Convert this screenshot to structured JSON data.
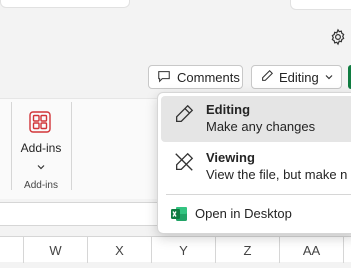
{
  "toolbar": {
    "comments_label": "Comments",
    "mode_label": "Editing",
    "settings_icon": "gear-icon",
    "comments_icon": "comment-icon",
    "mode_icon": "pencil-icon",
    "mode_chevron_icon": "chevron-down-icon"
  },
  "ribbon": {
    "addins_label": "Add-ins",
    "addins_group_label": "Add-ins",
    "addins_icon": "addins-grid-icon",
    "addins_chevron_icon": "chevron-down-icon",
    "accent": "#d13438"
  },
  "menu": {
    "items": [
      {
        "title": "Editing",
        "subtitle": "Make any changes",
        "icon": "pencil-icon",
        "selected": true
      },
      {
        "title": "Viewing",
        "subtitle": "View the file, but make n",
        "icon": "no-edit-pencil-icon",
        "selected": false
      }
    ],
    "open_desktop_label": "Open in Desktop",
    "open_desktop_icon": "excel-icon",
    "excel_color": "#107c41"
  },
  "grid": {
    "columns": [
      "W",
      "X",
      "Y",
      "Z",
      "AA"
    ]
  }
}
